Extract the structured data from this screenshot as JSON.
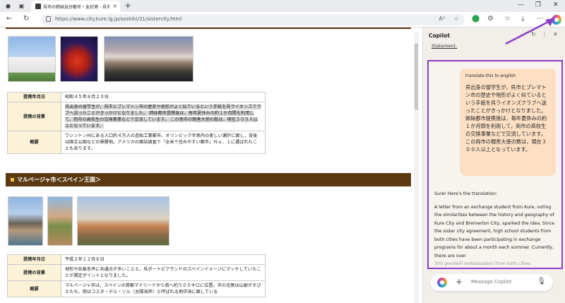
{
  "browser": {
    "tab_title": "呉市の姉妹友好都市・友好港 - 呉市",
    "tab_close": "×",
    "new_tab": "+",
    "url": "https://www.city.kure.lg.jp/soshiki/31/sistercity.html",
    "icons": {
      "back": "←",
      "refresh": "↻",
      "info": "ⓘ",
      "read_aloud": "A⁰",
      "favorite": "☆",
      "extension": "⬤",
      "puzzle": "⚙",
      "favorites_bar": "☆",
      "download": "⤓",
      "more": "⋯",
      "minimize": "—",
      "restore": "❐",
      "close": "✕"
    }
  },
  "page": {
    "table1": [
      {
        "label": "提携年月日",
        "value": "昭和４５年８月２０日"
      },
      {
        "label": "提携の背景",
        "value": "呉出身の留学生が，呉市とブレマトン市の歴史や地形がよく似ているという手紙を呉ライオンズクラブへ送ったことがきっかけとなりました。 姉妹都市提携後は，毎年夏休みの約１か月間を利用して，両市の高校生の交換事業などで交流しています。 この両市の親善大使の数は，現在３００人以上となっています。"
      },
      {
        "label": "概要",
        "value": "ワシントン州にある人口約４万人の造船工業都市。オリンピック半島内の美しい瀬戸に面し，背後は国立公園などの景勝地。アメリカの雑誌調査で「全米で住みやすい都市」Ｎｏ．１に選ばれたこともあります。"
      }
    ],
    "section_title": "マルベージャ市＜スペイン王国＞",
    "table2": [
      {
        "label": "提携年月日",
        "value": "平成２年１２月６日"
      },
      {
        "label": "提携の背景",
        "value": "地形や気象条件に共通点が多いことと，呉ポートピアランドのスペインイメージにマッチしていたことが選定ポイントとなりました。"
      },
      {
        "label": "概要",
        "value": "マルベージャ市は，スペインの首都マドリードから南へ約５００キロに位置。市の北側は山脈がそびえたち，南はコスタ・デル・ソル（太陽海岸）と呼ばれる地中海に面している"
      }
    ]
  },
  "copilot": {
    "title": "Copilot",
    "statement_link": "Statement.",
    "user_prompt": "translate this to english",
    "user_text": "呉出身の留学生が，呉市とブレマトン市の歴史や地形がよく似ているという手紙を呉ライオンズクラブへ送ったことがきっかけとなりました。 姉妹都市提携後は，毎年夏休みの約１か月間を利用して，両市の高校生の交換事業などで交流しています。 この両市の親善大使の数は，現在３００人以上となっています。",
    "reply_heading": "Sure! Here's the translation:",
    "reply_text": "A letter from an exchange student from Kure, noting the similarities between the history and geography of Kure City and Bremerton City, sparked the idea. Since the sister city agreement, high school students from both cities have been participating in exchange programs for about a month each summer. Currently, there are over",
    "reply_faded": "300 goodwill ambassadors from both cities.",
    "input_placeholder": "Message Copilot",
    "icons": {
      "refresh": "↻",
      "more": "⋮",
      "close": "✕",
      "plus": "+",
      "mic": "🎙"
    }
  },
  "colors": {
    "section_bar": "#5b3a12",
    "accent_purple": "#8b3fc6",
    "table_header_bg": "#fbf2d8",
    "user_bubble": "#fde0c4"
  }
}
